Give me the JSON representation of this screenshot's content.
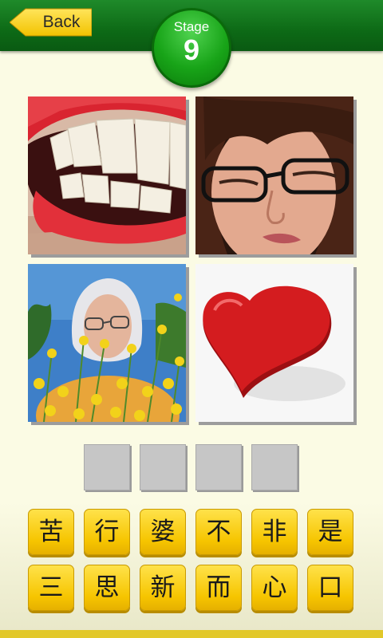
{
  "header": {
    "back_label": "Back",
    "stage_label": "Stage",
    "stage_number": "9"
  },
  "pictures": [
    {
      "subject": "smiling red lips with teeth"
    },
    {
      "subject": "woman with glasses squinting"
    },
    {
      "subject": "elderly woman among yellow flowers"
    },
    {
      "subject": "red 3D heart"
    }
  ],
  "answer_slots": [
    "",
    "",
    "",
    ""
  ],
  "letter_keys": {
    "row1": [
      "苦",
      "行",
      "婆",
      "不",
      "非",
      "是"
    ],
    "row2": [
      "三",
      "思",
      "新",
      "而",
      "心",
      "口"
    ]
  },
  "colors": {
    "header_green": "#0d6a16",
    "badge_green": "#18a418",
    "key_yellow": "#f6c500",
    "slot_gray": "#c6c6c6",
    "background": "#fbfbe4"
  },
  "icons": [
    "back-arrow-icon"
  ]
}
